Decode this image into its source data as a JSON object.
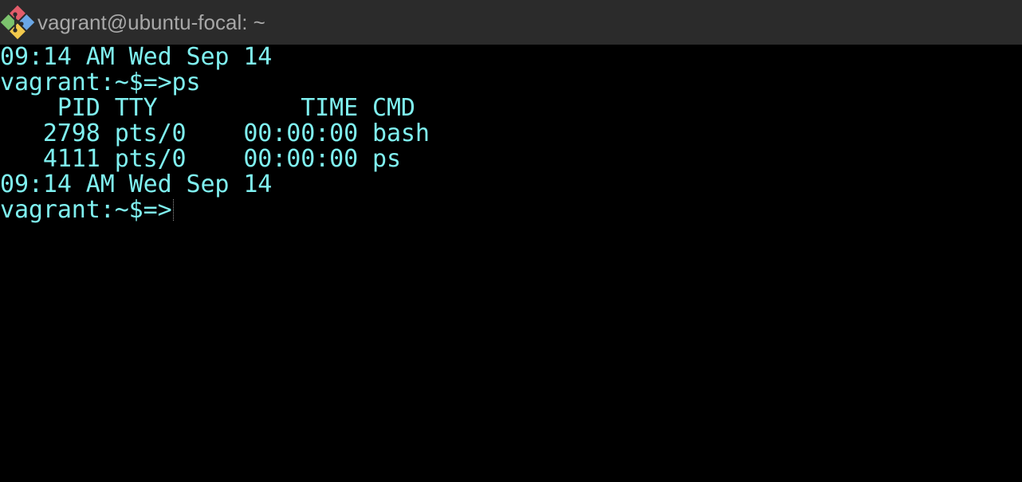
{
  "window": {
    "title": "vagrant@ubuntu-focal: ~",
    "icon": "git-bash-diamond-icon"
  },
  "colors": {
    "titlebar_bg": "#2b2b2b",
    "titlebar_text": "#a8a8a8",
    "terminal_bg": "#000000",
    "terminal_fg": "#7ff0f0"
  },
  "terminal": {
    "lines": [
      "09:14 AM Wed Sep 14",
      "vagrant:~$=>ps",
      "    PID TTY          TIME CMD",
      "   2798 pts/0    00:00:00 bash",
      "   4111 pts/0    00:00:00 ps",
      "09:14 AM Wed Sep 14",
      "vagrant:~$=>"
    ]
  }
}
